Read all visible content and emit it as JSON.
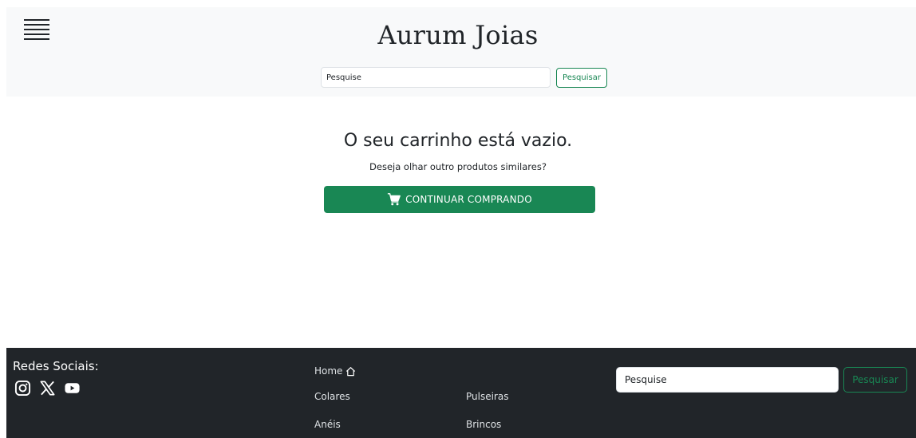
{
  "header": {
    "brand": "Aurum Joias",
    "search_placeholder": "Pesquise",
    "search_button": "Pesquisar",
    "menu_icon": "hamburger-menu-icon"
  },
  "main": {
    "title": "O seu carrinho está vazio.",
    "subtitle": "Deseja olhar outro produtos similares?",
    "continue_button": "CONTINUAR COMPRANDO",
    "continue_icon": "cart-icon"
  },
  "footer": {
    "social_title": "Redes Sociais:",
    "social_icons": [
      "instagram-icon",
      "x-icon",
      "youtube-icon"
    ],
    "nav": {
      "home": "Home",
      "colares": "Colares",
      "pulseiras": "Pulseiras",
      "aneis": "Anéis",
      "brincos": "Brincos"
    },
    "search_placeholder": "Pesquise",
    "search_button": "Pesquisar"
  },
  "colors": {
    "accent": "#198754",
    "header_bg": "#f8f9fa",
    "footer_bg": "#212529"
  }
}
